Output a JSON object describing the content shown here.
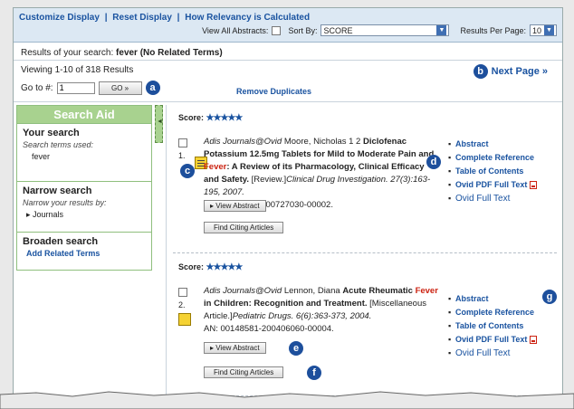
{
  "toolbar": {
    "links": [
      "Customize Display",
      "Reset Display",
      "How Relevancy is Calculated"
    ],
    "separator": "|",
    "view_all_abstracts_label": "View All Abstracts:",
    "sort_by_label": "Sort By:",
    "sort_by_value": "SCORE",
    "results_per_page_label": "Results Per Page:",
    "results_per_page_value": "10"
  },
  "results": {
    "summary_prefix": "Results of your search:",
    "summary_query": "fever (No Related Terms)",
    "viewing": "Viewing 1-10 of 318 Results",
    "goto_label": "Go to #:",
    "goto_value": "1",
    "go_button": "GO »",
    "next_page": "Next Page »",
    "remove_duplicates": "Remove Duplicates"
  },
  "search_aid": {
    "title": "Search Aid",
    "your_search": {
      "heading": "Your search",
      "sub": "Search terms used:",
      "term": "fever"
    },
    "narrow": {
      "heading": "Narrow search",
      "sub": "Narrow your results by:",
      "item": "▸ Journals"
    },
    "broaden": {
      "heading": "Broaden search",
      "link": "Add Related Terms"
    }
  },
  "records": [
    {
      "score_label": "Score:",
      "stars": "★★★★★",
      "number": "1.",
      "source": "Adis Journals@Ovid",
      "authors": "Moore, Nicholas 1 2",
      "title_pre": "Diclofenac Potassium 12.5mg Tablets for Mild to Moderate Pain and",
      "title_fever": "Fever",
      "title_post": ": A Review of its Pharmacology, Clinical Efficacy and Safety.",
      "pub_type": "[Review.]",
      "journal": "Clinical Drug Investigation. 27(3):163-195, 2007.",
      "an": "AN: 00044011-200727030-00002.",
      "view_abstract": "▸ View Abstract",
      "find_citing": "Find Citing Articles",
      "links": [
        "Abstract",
        "Complete Reference",
        "Table of Contents",
        "Ovid PDF Full Text",
        "Ovid Full Text"
      ]
    },
    {
      "score_label": "Score:",
      "stars": "★★★★★",
      "number": "2.",
      "source": "Adis Journals@Ovid",
      "authors": "Lennon, Diana",
      "title_pre": "Acute Rheumatic",
      "title_fever": "Fever",
      "title_post": " in Children: Recognition and Treatment.",
      "pub_type": "[Miscellaneous Article.]",
      "journal": "Pediatric Drugs. 6(6):363-373, 2004.",
      "an": "AN: 00148581-200406060-00004.",
      "view_abstract": "▸ View Abstract",
      "find_citing": "Find Citing Articles",
      "links": [
        "Abstract",
        "Complete Reference",
        "Table of Contents",
        "Ovid PDF Full Text",
        "Ovid Full Text"
      ]
    }
  ],
  "callouts": [
    "a",
    "b",
    "c",
    "d",
    "e",
    "f",
    "g"
  ],
  "colors": {
    "link_blue": "#1a53a0",
    "fever_red": "#c21",
    "search_aid_green": "#a8d28f",
    "callout_navy": "#1d4f9c",
    "toolbar_bg": "#dce8f3"
  }
}
